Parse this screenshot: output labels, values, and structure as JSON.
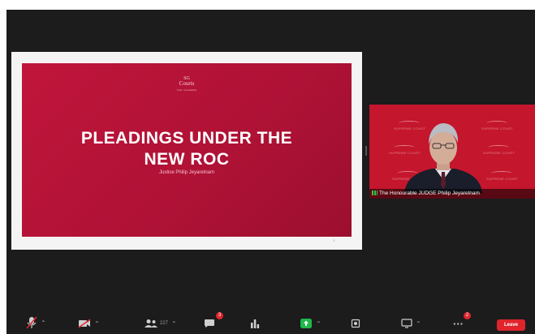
{
  "slide": {
    "logo_line1": "SG",
    "logo_line2": "Courts",
    "logo_tagline": "Trust • Accessibility",
    "title_line1": "PLEADINGS UNDER THE",
    "title_line2": "NEW ROC",
    "subtitle": "Justice Philip Jeyaretnam",
    "page_marker": "1"
  },
  "speaker": {
    "name": "The Honourable JUDGE Philip Jeyaretnam",
    "watermark_text": "SUPREME COURT"
  },
  "toolbar": {
    "participants_count": "227",
    "chat_badge": "3",
    "more_badge": "2",
    "leave_label": "Leave"
  },
  "colors": {
    "window_bg": "#1c1c1c",
    "slide_red": "#c0153b",
    "video_bg": "#c4162c",
    "share_green": "#1eb84a",
    "leave_red": "#e0242b"
  },
  "icons": [
    "mute-icon",
    "video-icon",
    "participants-icon",
    "chat-icon",
    "polls-icon",
    "share-screen-icon",
    "record-icon",
    "apps-icon",
    "more-icon"
  ]
}
